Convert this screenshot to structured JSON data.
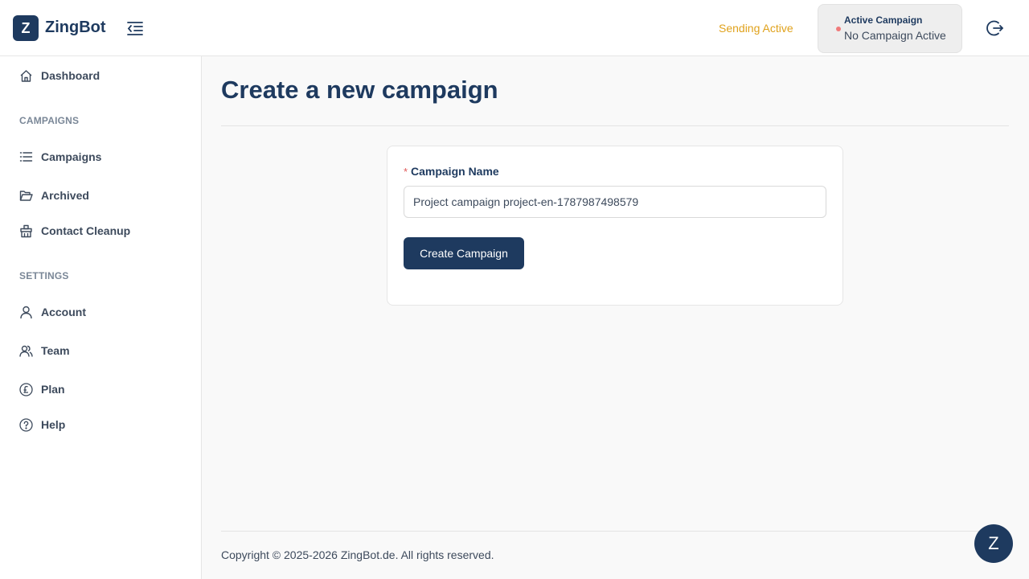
{
  "header": {
    "logo_letter": "Z",
    "app_name": "ZingBot",
    "sending_status": "Sending Active",
    "active_campaign_title": "Active Campaign",
    "active_campaign_value": "No Campaign Active"
  },
  "sidebar": {
    "dashboard": "Dashboard",
    "section_campaigns": "CAMPAIGNS",
    "campaigns": "Campaigns",
    "archived": "Archived",
    "contact_cleanup": "Contact Cleanup",
    "section_settings": "SETTINGS",
    "account": "Account",
    "team": "Team",
    "plan": "Plan",
    "help": "Help"
  },
  "main": {
    "title": "Create a new campaign",
    "form": {
      "required_mark": "*",
      "label": "Campaign Name",
      "value": "Project campaign project-en-1787987498579",
      "submit_label": "Create Campaign"
    }
  },
  "footer": {
    "copyright": "Copyright © 2025-2026 ZingBot.de. All rights reserved."
  },
  "chat_widget": {
    "letter": "Z"
  },
  "colors": {
    "brand": "#1e3a5f",
    "sending_status": "#e0a21c",
    "inactive_dot": "#f07a7a"
  }
}
